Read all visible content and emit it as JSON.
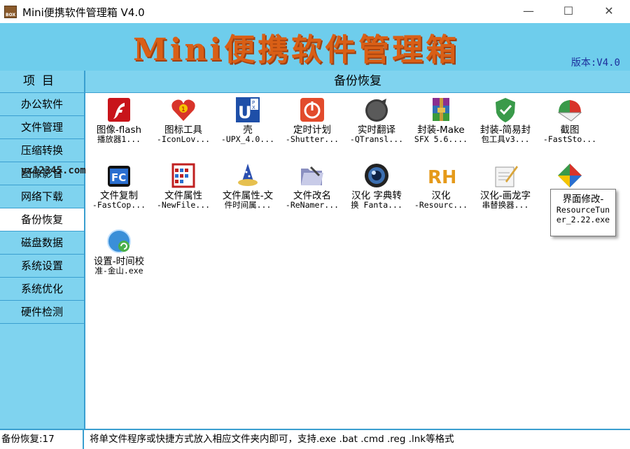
{
  "window": {
    "title": "Mini便携软件管理箱 V4.0",
    "app_icon_text": "BOX",
    "minimize": "—",
    "maximize": "☐",
    "close": "✕"
  },
  "banner": {
    "title": "Mini便携软件管理箱",
    "version": "版本:V4.0"
  },
  "sidebar": {
    "header": "项目",
    "items": [
      {
        "label": "办公软件",
        "active": false
      },
      {
        "label": "文件管理",
        "active": false
      },
      {
        "label": "压缩转换",
        "active": false
      },
      {
        "label": "图像影音",
        "active": false
      },
      {
        "label": "网络下载",
        "active": false
      },
      {
        "label": "备份恢复",
        "active": true
      },
      {
        "label": "磁盘数据",
        "active": false
      },
      {
        "label": "系统设置",
        "active": false
      },
      {
        "label": "系统优化",
        "active": false
      },
      {
        "label": "硬件检测",
        "active": false
      }
    ]
  },
  "main": {
    "header": "备份恢复",
    "tiles": [
      {
        "line1": "图像-flash",
        "line2": "播放器1...",
        "icon": "flash-icon"
      },
      {
        "line1": "图标工具",
        "line2": "-IconLov...",
        "icon": "heart-icon"
      },
      {
        "line1": "壳",
        "line2": "-UPX_4.0...",
        "icon": "upx-icon"
      },
      {
        "line1": "定时计划",
        "line2": "-Shutter...",
        "icon": "power-icon"
      },
      {
        "line1": "实时翻译",
        "line2": "-QTransl...",
        "icon": "translate-icon"
      },
      {
        "line1": "封装-Make",
        "line2": "SFX 5.6....",
        "icon": "winrar-icon"
      },
      {
        "line1": "封装-简易封",
        "line2": "包工具v3...",
        "icon": "shield-icon"
      },
      {
        "line1": "截图",
        "line2": "-FastSto...",
        "icon": "screenshot-icon"
      },
      {
        "line1": "文件复制",
        "line2": "-FastCop...",
        "icon": "fastcopy-icon"
      },
      {
        "line1": "文件属性",
        "line2": "-NewFile...",
        "icon": "calendar-icon"
      },
      {
        "line1": "文件属性-文",
        "line2": "件时间属...",
        "icon": "wizard-icon"
      },
      {
        "line1": "文件改名",
        "line2": "-ReNamer...",
        "icon": "folder-icon"
      },
      {
        "line1": "汉化 字典转",
        "line2": "换 Fanta...",
        "icon": "lens-icon"
      },
      {
        "line1": "汉化",
        "line2": "-Resourc...",
        "icon": "rh-icon"
      },
      {
        "line1": "汉化-画龙字",
        "line2": "串替换器...",
        "icon": "pen-icon"
      },
      {
        "line1": "设置-时间校",
        "line2": "准-金山.exe",
        "icon": "globe-sync-icon"
      }
    ],
    "tooltip": {
      "line1": "界面修改-",
      "line2": "ResourceTun",
      "line3": "er_2.22.exe",
      "icon": "diamond-icon"
    },
    "watermark": "yx12345.com"
  },
  "status": {
    "left": "备份恢复:17",
    "right": "将单文件程序或快捷方式放入相应文件夹内即可，支持.exe .bat .cmd .reg .lnk等格式"
  },
  "colors": {
    "banner_bg": "#6ecdec",
    "sidebar_bg": "#7fd3ef",
    "border": "#3a9fd0",
    "title_orange": "#d95f16",
    "version_blue": "#1d2f9c"
  }
}
